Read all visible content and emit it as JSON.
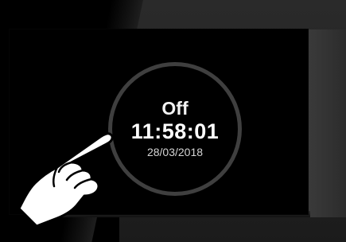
{
  "thermostat": {
    "state": "Off",
    "time": "11:58:01",
    "date": "28/03/2018"
  },
  "icons": {
    "hand": "pointing-hand-icon"
  },
  "colors": {
    "background": "#000000",
    "ring": "#3f3f3f",
    "primary_text": "#ffffff",
    "secondary_text": "#d4d4d4"
  }
}
